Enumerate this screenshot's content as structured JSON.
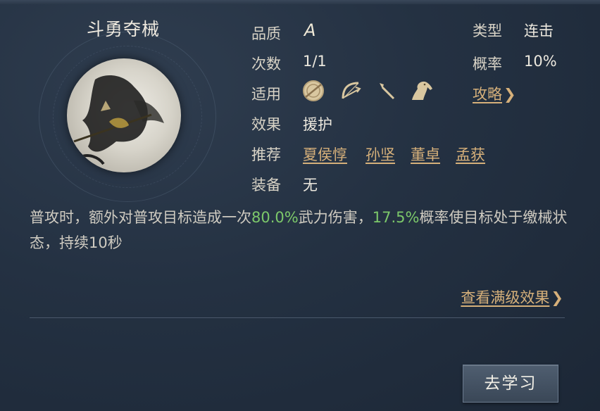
{
  "skill": {
    "name": "斗勇夺械",
    "quality_label": "品质",
    "quality_value": "A",
    "type_label": "类型",
    "type_value": "连击",
    "count_label": "次数",
    "count_value": "1/1",
    "chance_label": "概率",
    "chance_value": "10%",
    "applies_label": "适用",
    "applies_icons": [
      "shield-icon",
      "bow-icon",
      "spear-icon",
      "horse-icon"
    ],
    "guide_link": "攻略",
    "effect_label": "效果",
    "effect_value": "援护",
    "recommend_label": "推荐",
    "recommend": [
      "夏侯惇",
      "孙坚",
      "董卓",
      "孟获"
    ],
    "equip_label": "装备",
    "equip_value": "无"
  },
  "description": {
    "part1": "普攻时，额外对普攻目标造成一次",
    "hl1": "80.0%",
    "part2": "武力伤害，",
    "hl2": "17.5%",
    "part3": "概率使目标处于缴械状态，持续10秒"
  },
  "full_level_link": "查看满级效果",
  "learn_button": "去学习",
  "colors": {
    "highlight": "#7cc86a",
    "link": "#d6b07a"
  }
}
